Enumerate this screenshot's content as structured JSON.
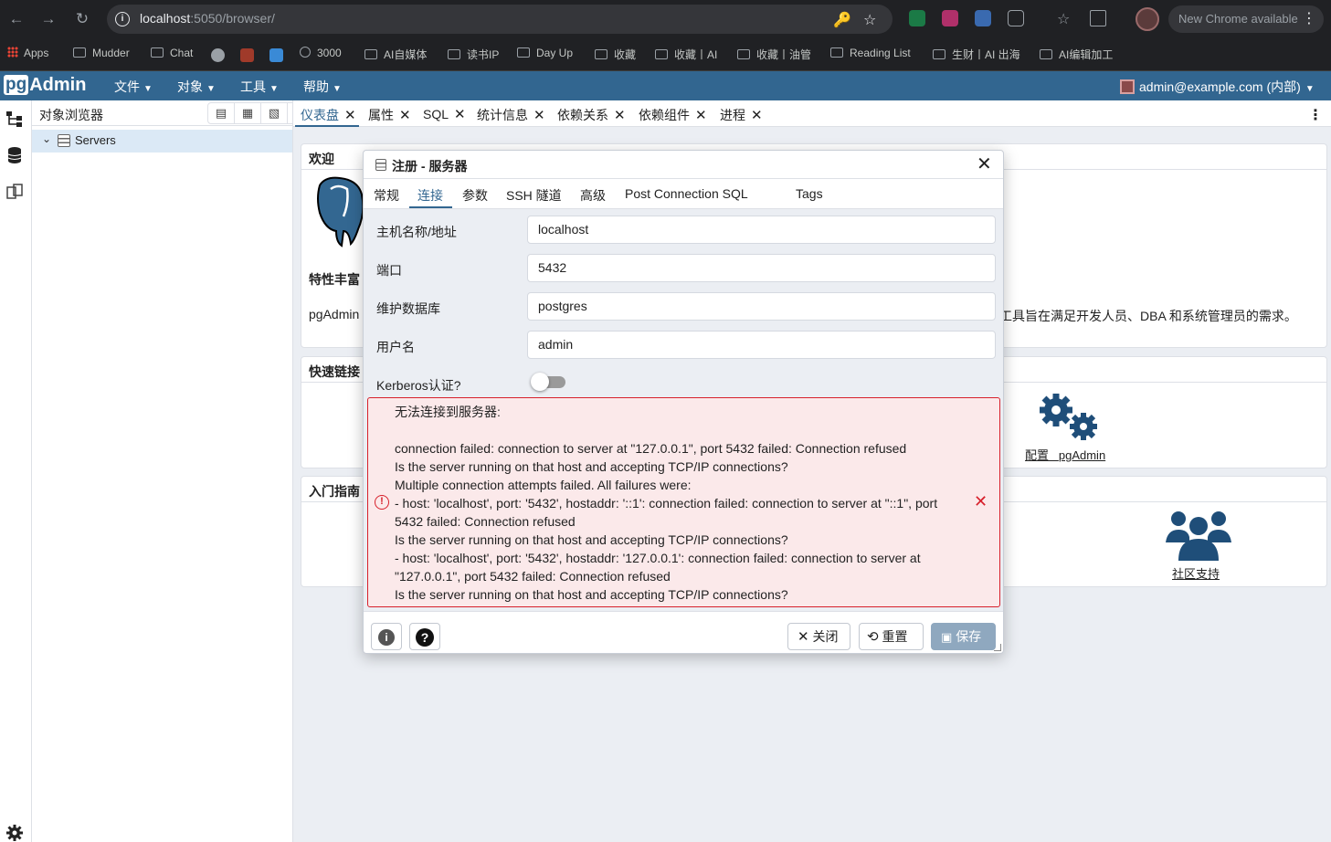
{
  "browser": {
    "url_host": "localhost",
    "url_path": ":5050/browser/",
    "update_label": "New Chrome available",
    "bookmarks": [
      "Apps",
      "Mudder",
      "Chat",
      "3000",
      "AI自媒体",
      "读书IP",
      "Day Up",
      "收藏",
      "收藏丨AI",
      "收藏丨油管",
      "Reading List",
      "生财丨AI 出海",
      "AI编辑加工"
    ]
  },
  "menubar": {
    "logo_pg": "pg",
    "logo_admin": "Admin",
    "items": [
      "文件",
      "对象",
      "工具",
      "帮助"
    ],
    "user": "admin@example.com (内部)"
  },
  "object_browser": {
    "title": "对象浏览器",
    "tree_root": "Servers"
  },
  "tabs": [
    "仪表盘",
    "属性",
    "SQL",
    "统计信息",
    "依赖关系",
    "依赖组件",
    "进程"
  ],
  "dashboard": {
    "welcome_title": "欢迎",
    "feature_title": "特性丰富",
    "intro_prefix": "pgAdmin",
    "intro_suffix": "工具旨在满足开发人员、DBA 和系统管理员的需求。",
    "quicklinks_title": "快速链接",
    "configure_label": "配置",
    "configure_link": "pgAdmin",
    "getting_started_title": "入门指南",
    "community_label": "社区支持"
  },
  "dialog": {
    "title": "注册 - 服务器",
    "tabs": [
      "常规",
      "连接",
      "参数",
      "SSH 隧道",
      "高级",
      "Post Connection SQL",
      "Tags"
    ],
    "fields": {
      "host_label": "主机名称/地址",
      "host_value": "localhost",
      "port_label": "端口",
      "port_value": "5432",
      "maintenance_db_label": "维护数据库",
      "maintenance_db_value": "postgres",
      "username_label": "用户名",
      "username_value": "admin",
      "kerberos_label": "Kerberos认证?",
      "kerberos_enabled": false
    },
    "error_lines": [
      "无法连接到服务器:",
      "",
      "connection failed: connection to server at \"127.0.0.1\", port 5432 failed: Connection refused",
      "Is the server running on that host and accepting TCP/IP connections?",
      "Multiple connection attempts failed. All failures were:",
      "- host: 'localhost', port: '5432', hostaddr: '::1': connection failed: connection to server at \"::1\", port",
      "5432 failed: Connection refused",
      "Is the server running on that host and accepting TCP/IP connections?",
      "- host: 'localhost', port: '5432', hostaddr: '127.0.0.1': connection failed: connection to server at",
      "\"127.0.0.1\", port 5432 failed: Connection refused",
      "Is the server running on that host and accepting TCP/IP connections?"
    ],
    "buttons": {
      "close": "关闭",
      "reset": "重置",
      "save": "保存"
    }
  },
  "colors": {
    "brand": "#326690",
    "error": "#d7202b",
    "error_bg": "#fbe9ea",
    "content_bg": "#ebeef3"
  },
  "icons": [
    "info-icon",
    "star-icon",
    "key-icon",
    "extensions-icon",
    "servers-icon",
    "gear-icon",
    "users-icon",
    "error-icon",
    "close-icon",
    "reset-icon",
    "save-icon",
    "help-icon",
    "elephant-logo"
  ]
}
